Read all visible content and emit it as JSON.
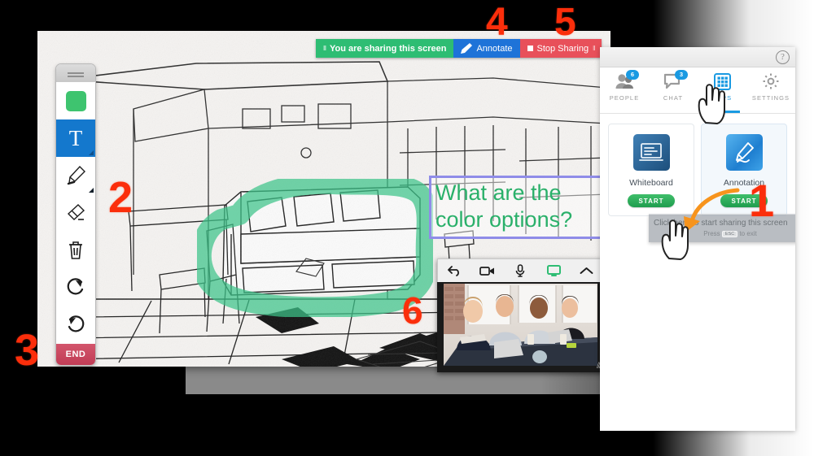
{
  "share_bar": {
    "status_label": "You are sharing this screen",
    "annotate_label": "Annotate",
    "stop_label": "Stop Sharing",
    "grip_glyph": "‖",
    "annotate_icon": "pen-icon",
    "stop_icon": "stop-square-icon",
    "colors": {
      "green": "#2ebd73",
      "blue": "#1e73d8",
      "red": "#e8505a"
    }
  },
  "toolbar": {
    "handle_name": "drag-handle",
    "items": [
      {
        "name": "color-swatch",
        "label": "",
        "color": "#3ec46f"
      },
      {
        "name": "text-tool",
        "label": "T",
        "selected": true
      },
      {
        "name": "highlighter-tool",
        "label": ""
      },
      {
        "name": "eraser-tool",
        "label": ""
      },
      {
        "name": "trash-tool",
        "label": ""
      },
      {
        "name": "redo-tool",
        "label": ""
      },
      {
        "name": "undo-tool",
        "label": ""
      }
    ],
    "end_label": "END"
  },
  "annotation_text": {
    "line1": "What are the",
    "line2": "color options?",
    "text_color": "#2ab06a",
    "border_color": "#8f8ce8"
  },
  "video_widget": {
    "controls": [
      "back-icon",
      "camera-icon",
      "microphone-icon",
      "screen-share-icon",
      "collapse-chevron-icon"
    ],
    "active_control": "screen-share-icon",
    "active_color": "#2ebd73",
    "resize_glyph": "⫻"
  },
  "app_panel": {
    "help_glyph": "?",
    "tabs": [
      {
        "label": "PEOPLE",
        "icon": "people-icon",
        "badge": "6",
        "active": false
      },
      {
        "label": "CHAT",
        "icon": "chat-icon",
        "badge": "3",
        "active": false
      },
      {
        "label": "APPS",
        "icon": "apps-grid-icon",
        "badge": "",
        "active": true
      },
      {
        "label": "SETTINGS",
        "icon": "gear-icon",
        "badge": "",
        "active": false
      }
    ],
    "accent_color": "#1a9ae2",
    "cards": [
      {
        "title": "Whiteboard",
        "icon": "whiteboard-icon",
        "start_label": "START",
        "highlighted": false
      },
      {
        "title": "Annotation",
        "icon": "annotation-pen-icon",
        "start_label": "START",
        "highlighted": true
      }
    ],
    "tooltip": {
      "main": "Click here to start sharing this screen",
      "prefix": "Press",
      "key": "ESC",
      "suffix": "to exit"
    }
  },
  "callouts": [
    {
      "id": "callout-1",
      "label": "1"
    },
    {
      "id": "callout-2",
      "label": "2"
    },
    {
      "id": "callout-3",
      "label": "3"
    },
    {
      "id": "callout-4",
      "label": "4"
    },
    {
      "id": "callout-5",
      "label": "5"
    },
    {
      "id": "callout-6",
      "label": "6"
    }
  ],
  "callout_color": "#fb2e0b"
}
